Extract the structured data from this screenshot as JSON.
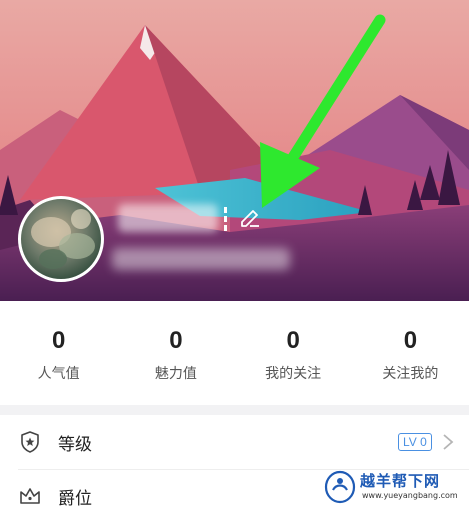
{
  "profile": {
    "nickname": "",
    "user_id": ""
  },
  "stats": [
    {
      "value": "0",
      "label": "人气值"
    },
    {
      "value": "0",
      "label": "魅力值"
    },
    {
      "value": "0",
      "label": "我的关注"
    },
    {
      "value": "0",
      "label": "关注我的"
    }
  ],
  "menu": {
    "level": {
      "label": "等级",
      "badge": "LV 0"
    },
    "title": {
      "label": "爵位"
    }
  },
  "watermark": {
    "site_name": "越羊帮下网",
    "url": "www.yueyangbang.com"
  },
  "icons": {
    "edit": "edit-pencil-icon",
    "level": "shield-star-icon",
    "title": "crown-icon",
    "chevron": "chevron-right-icon",
    "annotation_arrow": "green-arrow"
  },
  "colors": {
    "badge": "#4a90e2",
    "arrow": "#2ee82e",
    "divider": "#f2f2f4"
  }
}
